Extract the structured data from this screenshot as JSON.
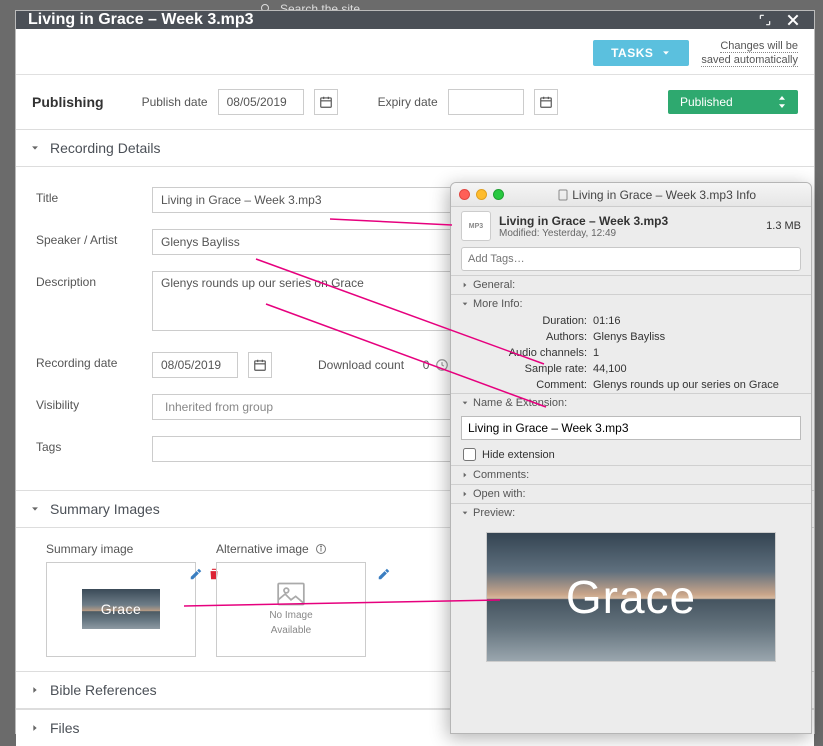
{
  "bg": {
    "search_placeholder": "Search the site"
  },
  "modal": {
    "title": "Living in Grace – Week 3.mp3",
    "tasks_btn": "TASKS",
    "autosave_l1": "Changes will be",
    "autosave_l2": "saved automatically"
  },
  "publishing": {
    "section_label": "Publishing",
    "publish_date_label": "Publish date",
    "publish_date": "08/05/2019",
    "expiry_date_label": "Expiry date",
    "expiry_date": "",
    "status": "Published"
  },
  "sections": {
    "recording_details": "Recording Details",
    "summary_images": "Summary Images",
    "bible_references": "Bible References",
    "files": "Files"
  },
  "recording": {
    "title_label": "Title",
    "title": "Living in Grace – Week 3.mp3",
    "speaker_label": "Speaker / Artist",
    "speaker": "Glenys Bayliss",
    "description_label": "Description",
    "description": "Glenys rounds up our series on Grace",
    "recording_date_label": "Recording date",
    "recording_date": "08/05/2019",
    "download_count_label": "Download count",
    "download_count": "0",
    "visibility_label": "Visibility",
    "visibility": "Inherited from group",
    "tags_label": "Tags"
  },
  "images": {
    "summary_label": "Summary image",
    "alternative_label": "Alternative image",
    "no_image_l1": "No Image",
    "no_image_l2": "Available",
    "thumb_text": "Grace"
  },
  "mac": {
    "window_title": "Living in Grace – Week 3.mp3 Info",
    "file_name": "Living in Grace – Week 3.mp3",
    "modified": "Modified: Yesterday, 12:49",
    "size": "1.3 MB",
    "tags_placeholder": "Add Tags…",
    "mp3_badge": "MP3",
    "disc_general": "General:",
    "disc_more_info": "More Info:",
    "disc_name_ext": "Name & Extension:",
    "disc_comments": "Comments:",
    "disc_open_with": "Open with:",
    "disc_preview": "Preview:",
    "more_info": {
      "duration_k": "Duration:",
      "duration_v": "01:16",
      "authors_k": "Authors:",
      "authors_v": "Glenys Bayliss",
      "channels_k": "Audio channels:",
      "channels_v": "1",
      "sample_k": "Sample rate:",
      "sample_v": "44,100",
      "comment_k": "Comment:",
      "comment_v": "Glenys rounds up our series on Grace"
    },
    "name_ext_value": "Living in Grace – Week 3.mp3",
    "hide_extension": "Hide extension",
    "preview_text": "Grace"
  }
}
